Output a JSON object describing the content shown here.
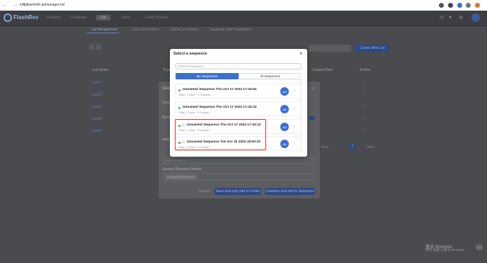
{
  "browser": {
    "nav_glyphs": "← → ↻",
    "url": "info.flashintel.ai/manager-list"
  },
  "app": {
    "logo": "FlashRev",
    "top_nav": [
      "Prospect",
      "Campaign",
      "List",
      "Inbox",
      "Flash Sidekick"
    ],
    "sub_nav": [
      "List Management",
      "CSV List Restore",
      "CSOA List History",
      "Suppress Upld Dashboard"
    ],
    "search_placeholder": "Search by list name",
    "create_button": "Create New List",
    "table_headers": [
      "List Name",
      "Type",
      "Created Date",
      "Action"
    ],
    "rows": [
      "test01",
      "test02",
      "test03",
      "test04",
      "test05"
    ],
    "pagination": {
      "page": "1",
      "next": "Next",
      "prev": "Prev"
    }
  },
  "background_dialog": {
    "title": "Select",
    "labels": [
      "Choose",
      "Dyna",
      "Add"
    ],
    "input_placeholder": "Input Shortcut",
    "assign_label": "Assign Shortcut Owner",
    "owner_tag": "unnamed@flashrev.io",
    "cancel": "Cancel",
    "save_only": "Save and only add to Folder",
    "continue": "Continue and add to Sequence"
  },
  "modal": {
    "title": "Select a sequence",
    "close_glyph": "×",
    "search_placeholder": "Search Sequence",
    "tabs": [
      {
        "label": "My Sequences",
        "active": true
      },
      {
        "label": "All Sequences",
        "active": false
      }
    ],
    "sequences": [
      {
        "name": "Unnamed Sequence Thu Oct 17 2024 17:34:52",
        "meta": "Step · 1 Hour · 1 Contacts",
        "shared": false
      },
      {
        "name": "Unnamed Sequence Thu Oct 17 2024 17:34:33",
        "meta": "Step · 1 Hour · 0 Contact",
        "shared": false
      },
      {
        "name": "Unnamed Sequence Thu Oct 17 2024 17:34:10",
        "meta": "Step · 1 Hour · 0 Contact",
        "shared": true
      },
      {
        "name": "Unnamed Sequence Tue Oct 15 2024 18:00:33",
        "meta": "Step · 1 Hour · 0 Contact",
        "shared": true
      }
    ],
    "icon_text": "AD"
  },
  "windows": {
    "activate_title": "激活 Windows",
    "activate_sub": "转到\"设置\"以激活 Windows。"
  },
  "colors": {
    "accent": "#3d6fd1",
    "highlight": "#e03030",
    "status_dot": "#3fae5a"
  }
}
